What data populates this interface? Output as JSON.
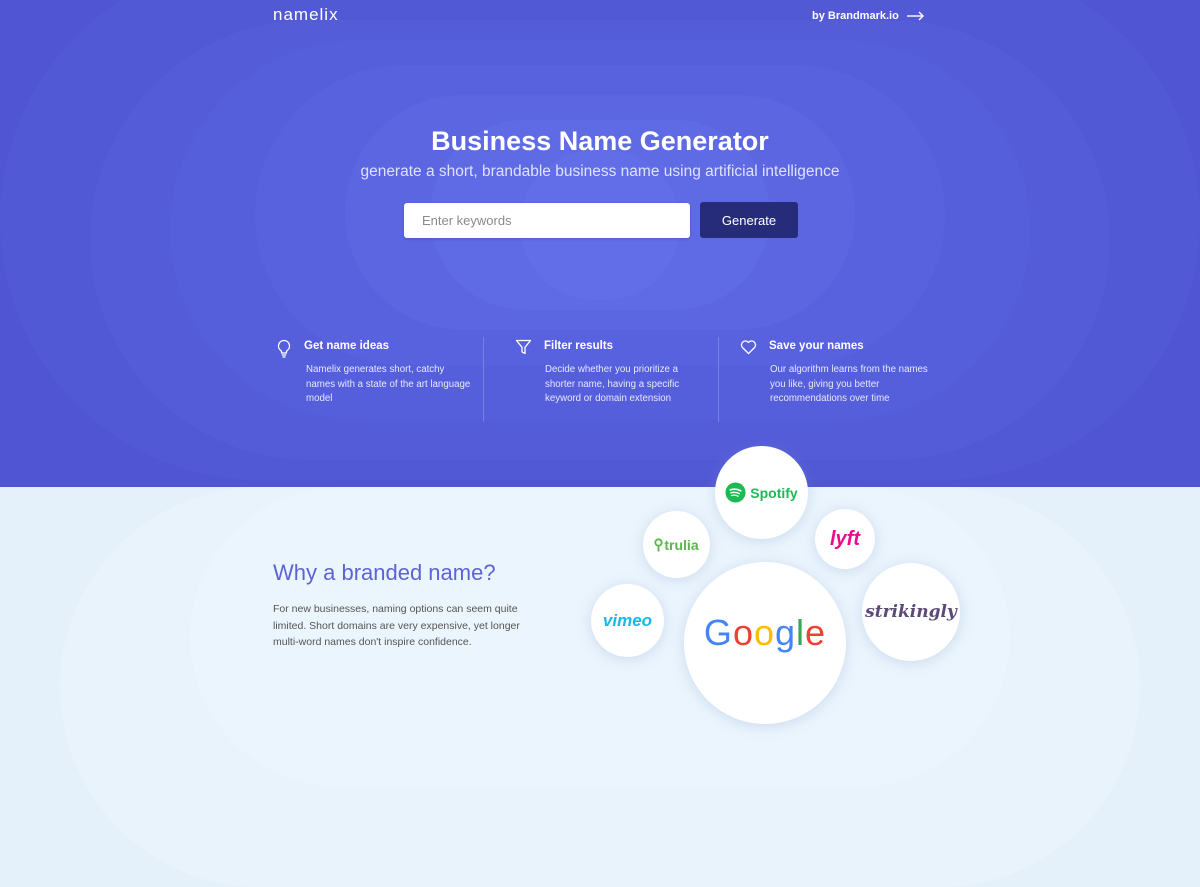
{
  "header": {
    "logo": "namelix",
    "brandmark_link": "by Brandmark.io"
  },
  "hero": {
    "title": "Business Name Generator",
    "subtitle": "generate a short, brandable business name using artificial intelligence",
    "search": {
      "placeholder": "Enter keywords",
      "value": ""
    },
    "generate_label": "Generate"
  },
  "features": [
    {
      "icon": "lightbulb-icon",
      "title": "Get name ideas",
      "text": "Namelix generates short, catchy names with a state of the art language model"
    },
    {
      "icon": "filter-icon",
      "title": "Filter results",
      "text": "Decide whether you prioritize a shorter name, having a specific keyword or domain extension"
    },
    {
      "icon": "heart-icon",
      "title": "Save your names",
      "text": "Our algorithm learns from the names you like, giving you better recommendations over time"
    }
  ],
  "why": {
    "title": "Why a branded name?",
    "text": "For new businesses, naming options can seem quite limited. Short domains are very expensive, yet longer multi-word names don't inspire confidence."
  },
  "brand_bubbles": {
    "spotify": "Spotify",
    "trulia": "trulia",
    "lyft": "lyft",
    "strikingly": "strikingly",
    "vimeo": "vimeo",
    "google": [
      "G",
      "o",
      "o",
      "g",
      "l",
      "e"
    ]
  },
  "colors": {
    "hero_bg": "#5056d3",
    "button_dark": "#272c7a",
    "why_title": "#5d63d3",
    "lower_bg": "#e4f1fb"
  }
}
